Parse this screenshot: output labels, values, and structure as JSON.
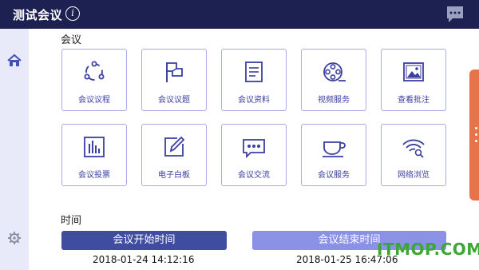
{
  "header": {
    "title": "测试会议",
    "info_glyph": "i",
    "chat_icon": "chat-bubble-icon",
    "bg": "#1c2152"
  },
  "sidebar": {
    "items": [
      {
        "icon": "home-icon"
      },
      {
        "icon": "gear-icon"
      }
    ]
  },
  "sections": {
    "meeting": "会议",
    "time": "时间"
  },
  "tiles": [
    {
      "label": "会议议程",
      "icon": "agenda-icon"
    },
    {
      "label": "会议议题",
      "icon": "flag-icon"
    },
    {
      "label": "会议资料",
      "icon": "document-icon"
    },
    {
      "label": "视频服务",
      "icon": "film-reel-icon"
    },
    {
      "label": "查看批注",
      "icon": "image-icon"
    },
    {
      "label": "会议投票",
      "icon": "bar-chart-icon"
    },
    {
      "label": "电子白板",
      "icon": "whiteboard-pen-icon"
    },
    {
      "label": "会议交流",
      "icon": "chat-dots-icon"
    },
    {
      "label": "会议服务",
      "icon": "coffee-cup-icon"
    },
    {
      "label": "网络浏览",
      "icon": "wifi-search-icon"
    }
  ],
  "time": {
    "start_label": "会议开始时间",
    "start_value": "2018-01-24 14:12:16",
    "end_label": "会议结束时间",
    "end_value": "2018-01-25 16:47:06"
  },
  "colors": {
    "accent": "#3a3fa0",
    "start_button": "#3f4ca0",
    "end_button": "#8a91e6",
    "tab": "#e7734a"
  },
  "watermark": "ITMOP.COM"
}
